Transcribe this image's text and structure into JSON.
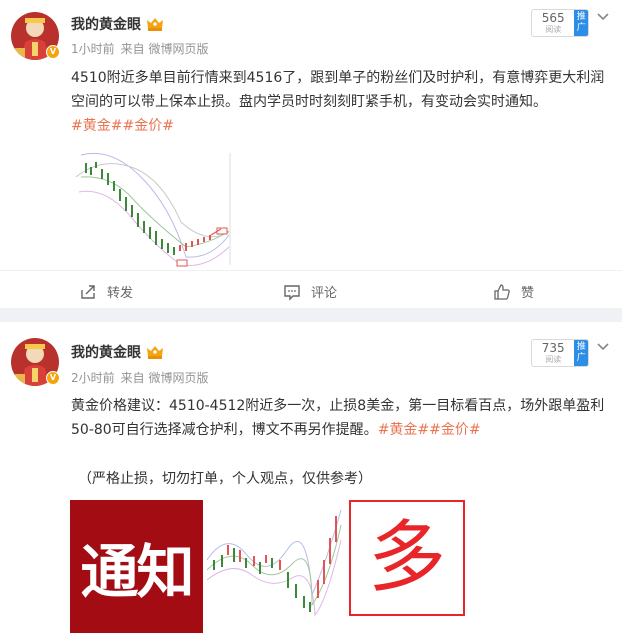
{
  "posts": [
    {
      "author": "我的黄金眼",
      "time": "1小时前",
      "source": "来自 微博网页版",
      "promo": {
        "count": "565",
        "sub": "阅读",
        "button": "推广"
      },
      "text": "4510附近多单目前行情来到4516了，跟到单子的粉丝们及时护利，有意博弈更大利润空间的可以带上保本止损。盘内学员时时刻刻盯紧手机，有变动会实时通知。",
      "tags": "#黄金##金价#",
      "actions": {
        "repost": "转发",
        "comment": "评论",
        "like": "赞"
      }
    },
    {
      "author": "我的黄金眼",
      "time": "2小时前",
      "source": "来自 微博网页版",
      "promo": {
        "count": "735",
        "sub": "阅读",
        "button": "推广"
      },
      "text": "黄金价格建议：4510-4512附近多一次，止损8美金，第一目标看百点，场外跟单盈利50-80可自行选择减仓护利，博文不再另作提醒。",
      "tags": "#黄金##金价#",
      "note": "（严格止损，切勿打单，个人观点，仅供参考）",
      "images": {
        "notice": "通知",
        "long": "多"
      }
    }
  ],
  "colors": {
    "tag": "#eb7350",
    "promo": "#2d8ee8",
    "badge": "#f4a40f",
    "notice_bg": "#a30c12",
    "long_red": "#e8262a"
  },
  "icons": [
    "crown-icon",
    "verified-icon",
    "chevron-down-icon",
    "repost-icon",
    "comment-icon",
    "like-icon"
  ]
}
